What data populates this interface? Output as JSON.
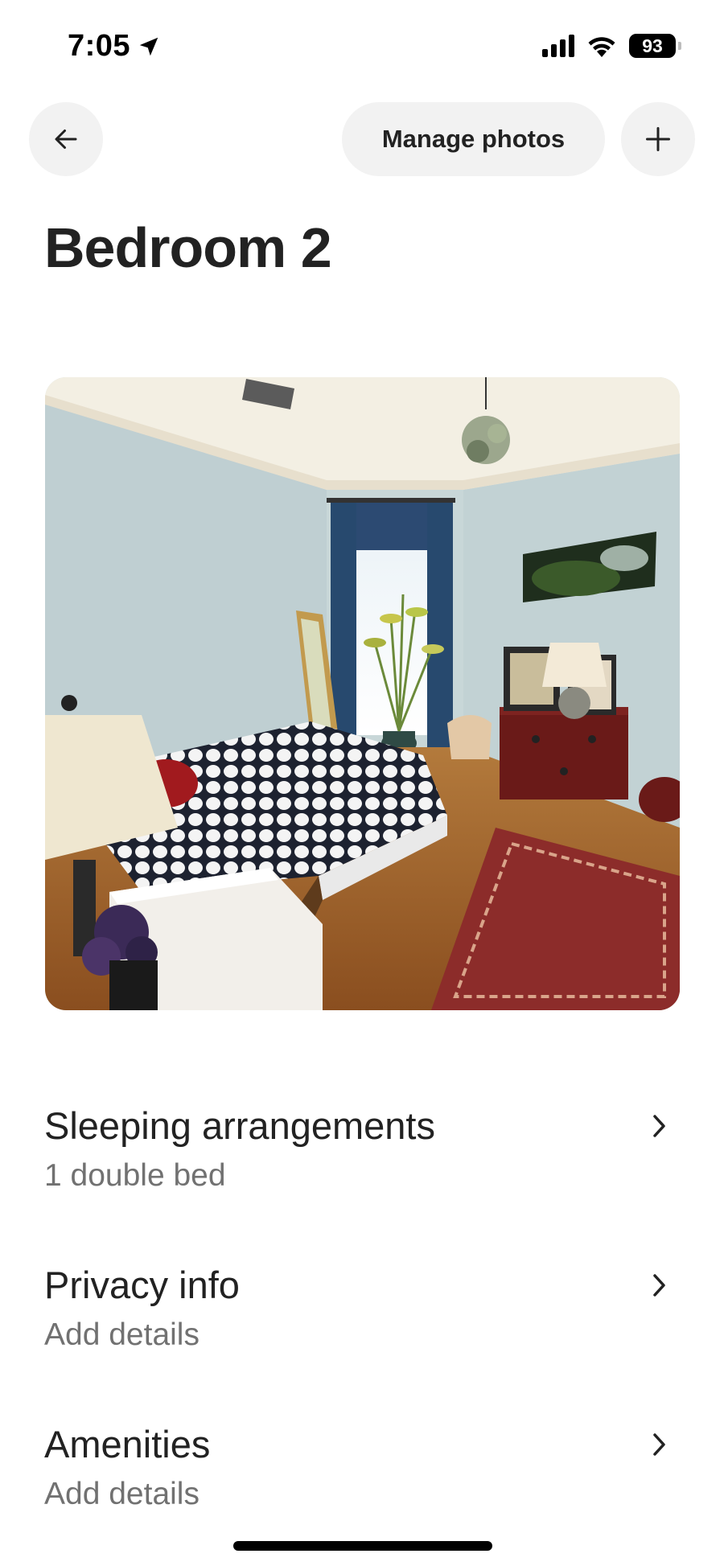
{
  "status_bar": {
    "time": "7:05",
    "battery": "93",
    "icons": [
      "location-arrow-icon",
      "cellular-signal-icon",
      "wifi-icon",
      "battery-icon"
    ]
  },
  "nav": {
    "back_icon": "arrow-left-icon",
    "manage_label": "Manage photos",
    "add_icon": "plus-icon"
  },
  "page": {
    "title": "Bedroom 2"
  },
  "photo": {
    "subject": "bedroom-photo"
  },
  "rows": [
    {
      "title": "Sleeping arrangements",
      "subtitle": "1 double bed",
      "icon": "chevron-right-icon"
    },
    {
      "title": "Privacy info",
      "subtitle": "Add details",
      "icon": "chevron-right-icon"
    },
    {
      "title": "Amenities",
      "subtitle": "Add details",
      "icon": "chevron-right-icon"
    }
  ],
  "colors": {
    "text_primary": "#222222",
    "text_secondary": "#717171",
    "button_bg": "#f2f2f2"
  }
}
